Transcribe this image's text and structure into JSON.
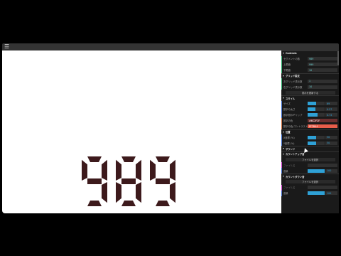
{
  "counter": {
    "value": "989",
    "color": "#3d1a1c"
  },
  "panel": {
    "sections": {
      "controls": "Controls",
      "grid": "グリッド設定",
      "style": "スタイル",
      "position": "位置",
      "sound": "サウンド",
      "countup": "カウントアップ音",
      "countdown": "カウントダウン音"
    },
    "controls": [
      {
        "label": "セグメントの数",
        "value": "989"
      },
      {
        "label": "上限値",
        "value": "999"
      },
      {
        "label": "下限値",
        "value": "10"
      }
    ],
    "grid": [
      {
        "label": "左グリッド表示数",
        "value": "1"
      },
      {
        "label": "右グリッド表示数",
        "value": "10"
      }
    ],
    "grid_button": "表示を更新する",
    "style": [
      {
        "label": "サイズ",
        "value": "69",
        "fill": 0.5
      },
      {
        "label": "数字の太さ",
        "value": "0.57",
        "fill": 0.45
      },
      {
        "label": "数字間のギャップ",
        "value": "0.74",
        "fill": 0.6
      },
      {
        "label": "数字の色",
        "value": "#6C2F2F",
        "color": "#6C2F2F"
      },
      {
        "label": "数字の色(コントラスト)",
        "value": "FF7B44",
        "color": "#e85d4a"
      }
    ],
    "position": [
      {
        "label": "X座標 (%)",
        "value": "50",
        "fill": 0.5
      },
      {
        "label": "Y座標 (%)",
        "value": "50",
        "fill": 0.5
      }
    ],
    "countup": {
      "file_button": "ファイルを選択",
      "file_label": "ファイル名",
      "file_value": "",
      "volume_label": "音量",
      "volume_value": "100",
      "volume_fill": 1.0
    },
    "countdown": {
      "file_button": "ファイルを選択",
      "file_label": "ファイル名",
      "file_value": "",
      "volume_label": "音量",
      "volume_value": "100",
      "volume_fill": 1.0
    }
  }
}
